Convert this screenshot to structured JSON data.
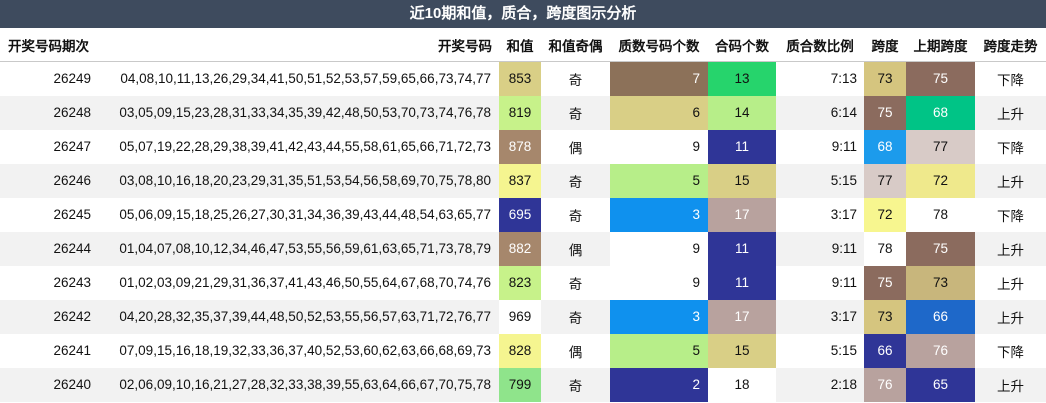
{
  "title": "近10期和值，质合，跨度图示分析",
  "headers": [
    "开奖号码期次",
    "开奖号码",
    "和值",
    "和值奇偶",
    "质数号码个数",
    "合码个数",
    "质合数比例",
    "跨度",
    "上期跨度",
    "跨度走势"
  ],
  "rows": [
    {
      "period": "26249",
      "numbers": "04,08,10,11,13,26,29,34,41,50,51,52,53,57,59,65,66,73,74,77",
      "sum": "853",
      "parity": "奇",
      "prime": "7",
      "composite": "13",
      "ratio": "7:13",
      "span": "73",
      "prev_span": "75",
      "trend": "下降",
      "colors": {
        "sum": "#d9cf86",
        "prime": "#8c7159",
        "composite": "#26d46c",
        "span": "#d5c57f",
        "prev_span": "#8b6b5e"
      },
      "text": {
        "sum": "#111",
        "prime": "#ffffff",
        "composite": "#111",
        "span": "#111",
        "prev_span": "#ffffff"
      }
    },
    {
      "period": "26248",
      "numbers": "03,05,09,15,23,28,31,33,34,35,39,42,48,50,53,70,73,74,76,78",
      "sum": "819",
      "parity": "奇",
      "prime": "6",
      "composite": "14",
      "ratio": "6:14",
      "span": "75",
      "prev_span": "68",
      "trend": "上升",
      "colors": {
        "sum": "#c7f28a",
        "prime": "#d9cf86",
        "composite": "#b7ee89",
        "span": "#8b6b5e",
        "prev_span": "#00c486"
      },
      "text": {
        "sum": "#111",
        "prime": "#111",
        "composite": "#111",
        "span": "#ffffff",
        "prev_span": "#ffffff"
      }
    },
    {
      "period": "26247",
      "numbers": "05,07,19,22,28,29,38,39,41,42,43,44,55,58,61,65,66,71,72,73",
      "sum": "878",
      "parity": "偶",
      "prime": "9",
      "composite": "11",
      "ratio": "9:11",
      "span": "68",
      "prev_span": "77",
      "trend": "下降",
      "colors": {
        "sum": "#a6876c",
        "prime": "#ffffff",
        "composite": "#2f3597",
        "span": "#1c9bec",
        "prev_span": "#d8cbc7"
      },
      "text": {
        "sum": "#ffffff",
        "prime": "#111",
        "composite": "#ffffff",
        "span": "#ffffff",
        "prev_span": "#111"
      }
    },
    {
      "period": "26246",
      "numbers": "03,08,10,16,18,20,23,29,31,35,51,53,54,56,58,69,70,75,78,80",
      "sum": "837",
      "parity": "奇",
      "prime": "5",
      "composite": "15",
      "ratio": "5:15",
      "span": "77",
      "prev_span": "72",
      "trend": "上升",
      "colors": {
        "sum": "#f5f590",
        "prime": "#b7ee89",
        "composite": "#d9cf86",
        "span": "#d8cbc7",
        "prev_span": "#efe98c"
      },
      "text": {
        "sum": "#111",
        "prime": "#111",
        "composite": "#111",
        "span": "#111",
        "prev_span": "#111"
      }
    },
    {
      "period": "26245",
      "numbers": "05,06,09,15,18,25,26,27,30,31,34,36,39,43,44,48,54,63,65,77",
      "sum": "695",
      "parity": "奇",
      "prime": "3",
      "composite": "17",
      "ratio": "3:17",
      "span": "72",
      "prev_span": "78",
      "trend": "下降",
      "colors": {
        "sum": "#2f3597",
        "prime": "#0f91ee",
        "composite": "#b8a29e",
        "span": "#f7f68f",
        "prev_span": "#ffffff"
      },
      "text": {
        "sum": "#ffffff",
        "prime": "#ffffff",
        "composite": "#ffffff",
        "span": "#111",
        "prev_span": "#111"
      }
    },
    {
      "period": "26244",
      "numbers": "01,04,07,08,10,12,34,46,47,53,55,56,59,61,63,65,71,73,78,79",
      "sum": "882",
      "parity": "偶",
      "prime": "9",
      "composite": "11",
      "ratio": "9:11",
      "span": "78",
      "prev_span": "75",
      "trend": "上升",
      "colors": {
        "sum": "#a6876c",
        "prime": "#ffffff",
        "composite": "#2f3597",
        "span": "#ffffff",
        "prev_span": "#8b6b5e"
      },
      "text": {
        "sum": "#ffffff",
        "prime": "#111",
        "composite": "#ffffff",
        "span": "#111",
        "prev_span": "#ffffff"
      }
    },
    {
      "period": "26243",
      "numbers": "01,02,03,09,21,29,31,36,37,41,43,46,50,55,64,67,68,70,74,76",
      "sum": "823",
      "parity": "奇",
      "prime": "9",
      "composite": "11",
      "ratio": "9:11",
      "span": "75",
      "prev_span": "73",
      "trend": "上升",
      "colors": {
        "sum": "#c7f28a",
        "prime": "#ffffff",
        "composite": "#2f3597",
        "span": "#8b6b5e",
        "prev_span": "#c8b67c"
      },
      "text": {
        "sum": "#111",
        "prime": "#111",
        "composite": "#ffffff",
        "span": "#ffffff",
        "prev_span": "#111"
      }
    },
    {
      "period": "26242",
      "numbers": "04,20,28,32,35,37,39,44,48,50,52,53,55,56,57,63,71,72,76,77",
      "sum": "969",
      "parity": "奇",
      "prime": "3",
      "composite": "17",
      "ratio": "3:17",
      "span": "73",
      "prev_span": "66",
      "trend": "上升",
      "colors": {
        "sum": "#ffffff",
        "prime": "#0f91ee",
        "composite": "#b8a29e",
        "span": "#d5c57f",
        "prev_span": "#1e68c9"
      },
      "text": {
        "sum": "#111",
        "prime": "#ffffff",
        "composite": "#ffffff",
        "span": "#111",
        "prev_span": "#ffffff"
      }
    },
    {
      "period": "26241",
      "numbers": "07,09,15,16,18,19,32,33,36,37,40,52,53,60,62,63,66,68,69,73",
      "sum": "828",
      "parity": "偶",
      "prime": "5",
      "composite": "15",
      "ratio": "5:15",
      "span": "66",
      "prev_span": "76",
      "trend": "下降",
      "colors": {
        "sum": "#f5f590",
        "prime": "#b7ee89",
        "composite": "#d9cf86",
        "span": "#2f3597",
        "prev_span": "#b8a29e"
      },
      "text": {
        "sum": "#111",
        "prime": "#111",
        "composite": "#111",
        "span": "#ffffff",
        "prev_span": "#ffffff"
      }
    },
    {
      "period": "26240",
      "numbers": "02,06,09,10,16,21,27,28,32,33,38,39,55,63,64,66,67,70,75,78",
      "sum": "799",
      "parity": "奇",
      "prime": "2",
      "composite": "18",
      "ratio": "2:18",
      "span": "76",
      "prev_span": "65",
      "trend": "上升",
      "colors": {
        "sum": "#8fe48b",
        "prime": "#2f3597",
        "composite": "#ffffff",
        "span": "#b8a29e",
        "prev_span": "#2f3597"
      },
      "text": {
        "sum": "#111",
        "prime": "#ffffff",
        "composite": "#111",
        "span": "#ffffff",
        "prev_span": "#ffffff"
      }
    }
  ]
}
